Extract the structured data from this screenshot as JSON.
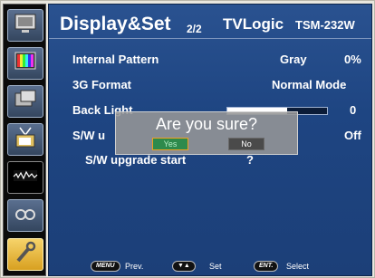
{
  "header": {
    "title": "Display&Set",
    "page": "2/2",
    "brand": "TVLogic",
    "model": "TSM-232W"
  },
  "sidebar": {
    "items": [
      {
        "icon": "monitor-icon"
      },
      {
        "icon": "color-bars-icon"
      },
      {
        "icon": "picture-in-picture-icon"
      },
      {
        "icon": "antenna-tv-icon"
      },
      {
        "icon": "waveform-icon"
      },
      {
        "icon": "glasses-icon"
      },
      {
        "icon": "wrench-icon",
        "active": true
      }
    ]
  },
  "settings": {
    "internal_pattern": {
      "label": "Internal Pattern",
      "value_name": "Gray",
      "value": "0%"
    },
    "format_3g": {
      "label": "3G Format",
      "value": "Normal Mode"
    },
    "backlight": {
      "label": "Back Light",
      "value": "0",
      "level_fraction": 0.6
    },
    "sw_upgrade": {
      "label": "S/W u",
      "value": "Off"
    },
    "sw_upgrade_start": {
      "label": "S/W upgrade start",
      "value": "?"
    }
  },
  "dialog": {
    "title": "Are you sure?",
    "yes_label": "Yes",
    "no_label": "No"
  },
  "footer": {
    "menu_key": "MENU",
    "menu_text": "Prev.",
    "arrow_key": "▼▲",
    "arrow_text": "Set",
    "ent_key": "ENT.",
    "ent_text": "Select"
  },
  "colors": {
    "panel_blue": "#1e4582",
    "active_tab": "#f6d36a",
    "yes_green": "#2e8a4c"
  }
}
